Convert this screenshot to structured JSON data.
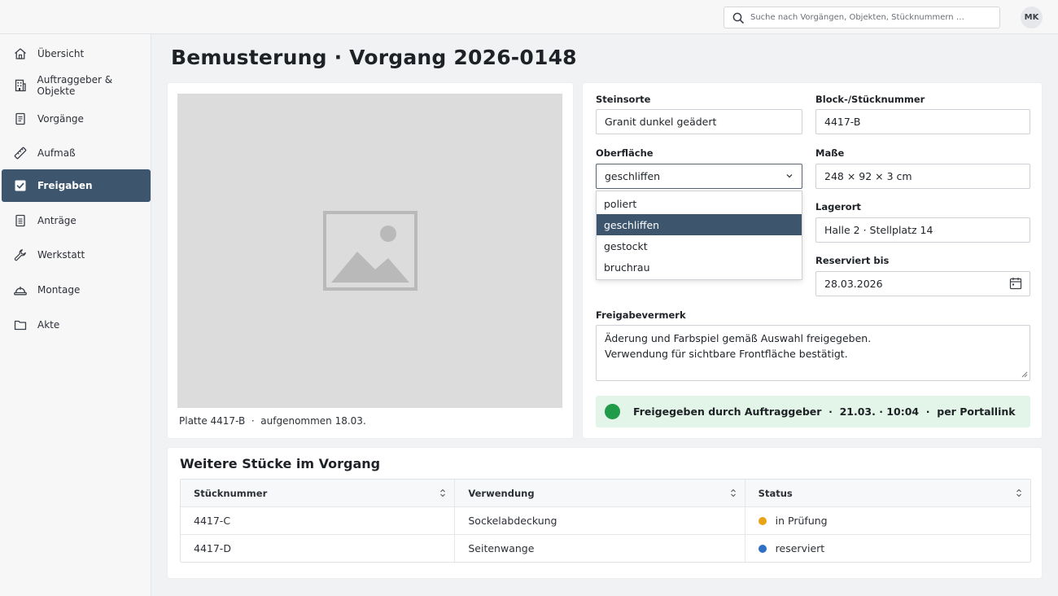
{
  "header": {
    "search_placeholder": "Suche nach Vorgängen, Objekten, Stücknummern …",
    "user_initials": "MK"
  },
  "sidebar": {
    "items": [
      {
        "label": "Übersicht",
        "icon": "home-icon"
      },
      {
        "label": "Auftraggeber & Objekte",
        "icon": "building-icon"
      },
      {
        "label": "Vorgänge",
        "icon": "document-icon"
      },
      {
        "label": "Aufmaß",
        "icon": "ruler-icon"
      },
      {
        "label": "Freigaben",
        "icon": "checkbox-icon",
        "active": true
      },
      {
        "label": "Anträge",
        "icon": "form-icon"
      },
      {
        "label": "Werkstatt",
        "icon": "wrench-icon"
      },
      {
        "label": "Montage",
        "icon": "helmet-icon"
      },
      {
        "label": "Akte",
        "icon": "folder-icon"
      }
    ]
  },
  "page": {
    "title": "Bemusterung · Vorgang 2026-0148"
  },
  "sample": {
    "caption": "Platte 4417-B  ·  aufgenommen 18.03."
  },
  "form": {
    "steinsorte": {
      "label": "Steinsorte",
      "value": "Granit dunkel geädert"
    },
    "stuecknummer": {
      "label": "Block-/Stücknummer",
      "value": "4417-B"
    },
    "oberflaeche": {
      "label": "Oberfläche",
      "value": "geschliffen",
      "options": [
        "poliert",
        "geschliffen",
        "gestockt",
        "bruchrau"
      ]
    },
    "masse": {
      "label": "Maße",
      "value": "248 × 92 × 3 cm"
    },
    "lagerort": {
      "label": "Lagerort",
      "value": "Halle 2 · Stellplatz 14"
    },
    "reserviert_bis": {
      "label": "Reserviert bis",
      "value": "28.03.2026"
    },
    "freigabevermerk": {
      "label": "Freigabevermerk",
      "value": "Äderung und Farbspiel gemäß Auswahl freigegeben.\nVerwendung für sichtbare Frontfläche bestätigt."
    },
    "status_banner": "Freigegeben durch Auftraggeber  ·  21.03. · 10:04  ·  per Portallink",
    "status_color": "#1f9b4a"
  },
  "table": {
    "title": "Weitere Stücke im Vorgang",
    "columns": [
      "Stücknummer",
      "Verwendung",
      "Status"
    ],
    "rows": [
      {
        "nummer": "4417-C",
        "verwendung": "Sockelabdeckung",
        "status": "in Prüfung",
        "status_color": "#e8a317"
      },
      {
        "nummer": "4417-D",
        "verwendung": "Seitenwange",
        "status": "reserviert",
        "status_color": "#2f6fc4"
      }
    ]
  }
}
